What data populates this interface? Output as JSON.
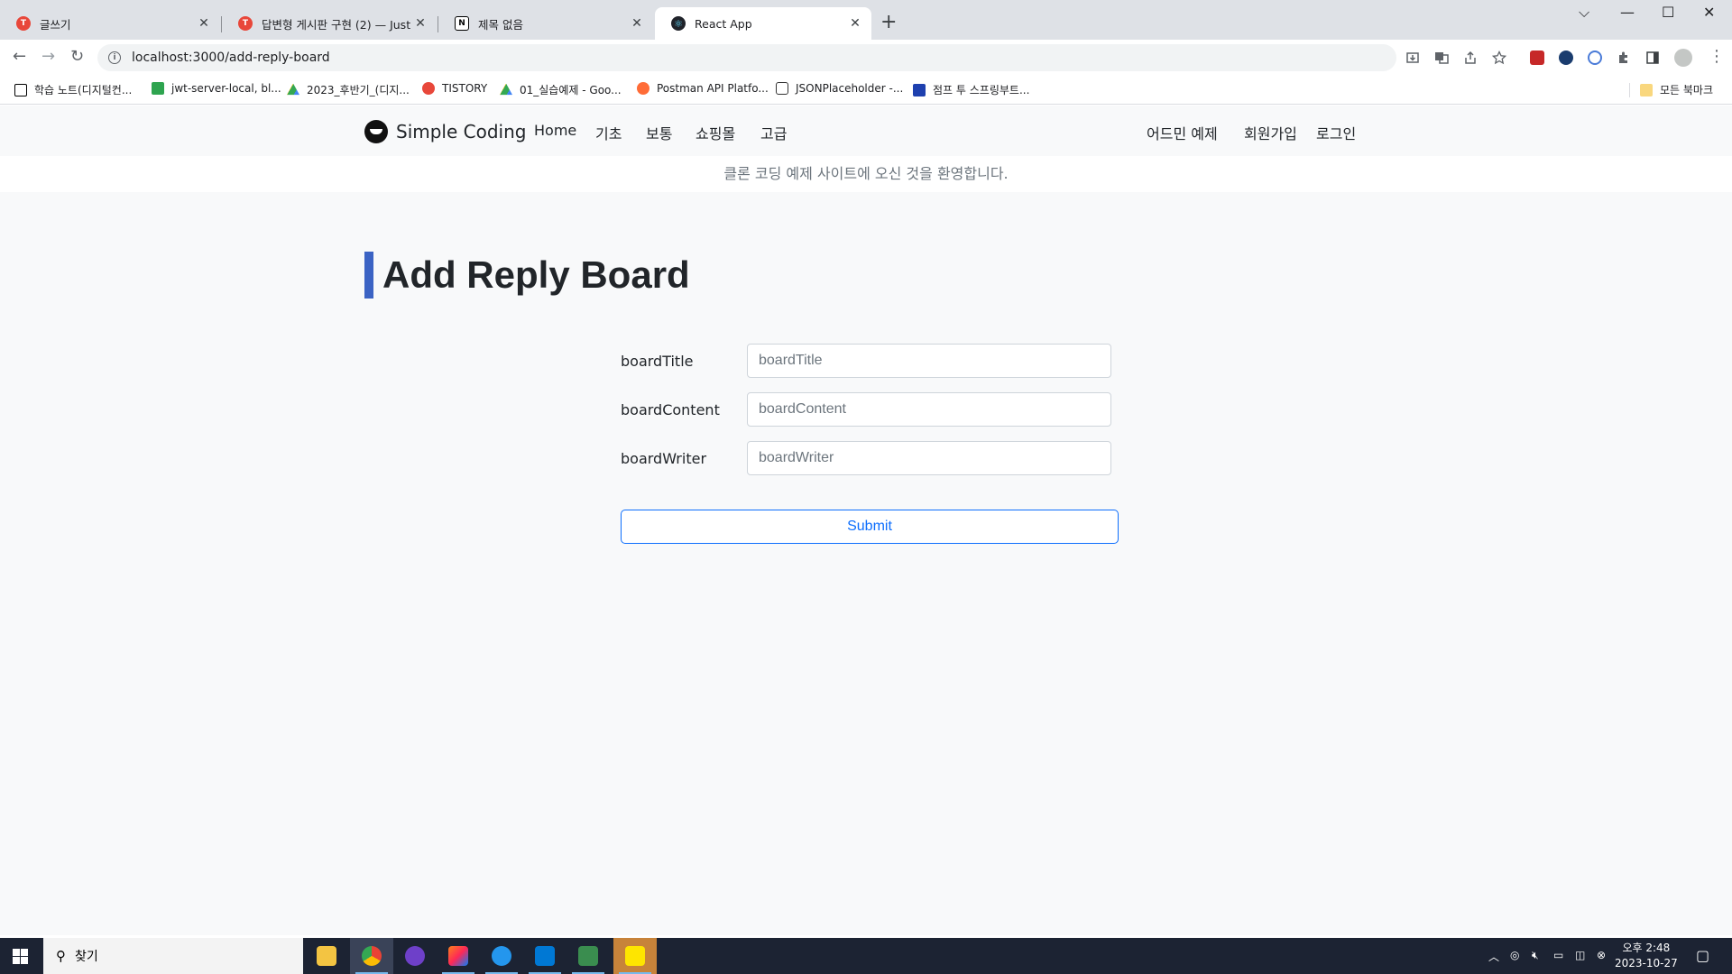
{
  "browser": {
    "tabs": [
      {
        "title": "글쓰기",
        "favicon_color": "#e8473a"
      },
      {
        "title": "답변형 게시판 구현 (2) — Just",
        "favicon_color": "#e8473a"
      },
      {
        "title": "제목 없음",
        "favicon_color": "#000000"
      },
      {
        "title": "React App",
        "favicon_color": "#20232a"
      }
    ],
    "new_tab_glyph": "+",
    "url": "localhost:3000/add-reply-board",
    "bookmarks": [
      {
        "label": "학습 노트(디지털컨...",
        "color": "#000000"
      },
      {
        "label": "jwt-server-local, bl...",
        "color": "#2ea44f"
      },
      {
        "label": "2023_후반기_(디지...",
        "color": "#fbbc04"
      },
      {
        "label": "TISTORY",
        "color": "#e8473a"
      },
      {
        "label": "01_실습예제 - Goo...",
        "color": "#1a73e8"
      },
      {
        "label": "Postman API Platfo...",
        "color": "#ff6c37"
      },
      {
        "label": "JSONPlaceholder -...",
        "color": "#333333"
      },
      {
        "label": "점프 투 스프링부트...",
        "color": "#1e40af"
      }
    ],
    "all_bookmarks_label": "모든 북마크"
  },
  "app": {
    "brand": "Simple Coding",
    "nav_left": [
      "Home",
      "기초",
      "보통",
      "쇼핑몰",
      "고급"
    ],
    "nav_right": [
      "어드민 예제",
      "회원가입",
      "로그인"
    ],
    "banner": "클론 코딩 예제 사이트에 오신 것을 환영합니다.",
    "page_title": "Add Reply Board",
    "accent_color": "#3b63c4",
    "form": {
      "fields": [
        {
          "label": "boardTitle",
          "placeholder": "boardTitle",
          "value": ""
        },
        {
          "label": "boardContent",
          "placeholder": "boardContent",
          "value": ""
        },
        {
          "label": "boardWriter",
          "placeholder": "boardWriter",
          "value": ""
        }
      ],
      "submit_label": "Submit"
    }
  },
  "taskbar": {
    "search_placeholder": "찾기",
    "time": "오후 2:48",
    "date": "2023-10-27",
    "apps": [
      "file-explorer-icon",
      "chrome-icon",
      "github-desktop-icon",
      "intellij-icon",
      "docker-icon",
      "vscode-icon",
      "media-player-icon",
      "kakaotalk-icon"
    ]
  }
}
